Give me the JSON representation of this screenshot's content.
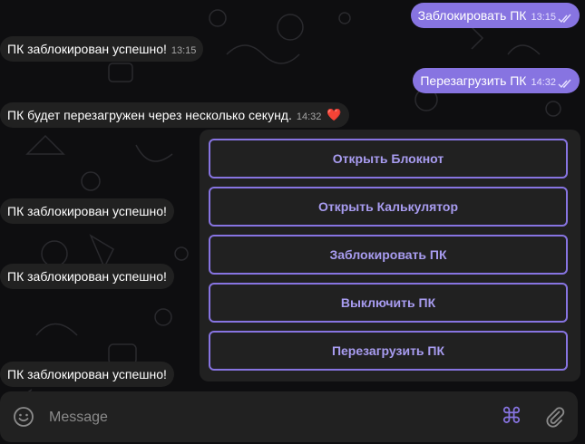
{
  "messages": [
    {
      "dir": "out",
      "text": "Заблокировать ПК",
      "time": "13:15",
      "read": true
    },
    {
      "dir": "in",
      "text": "ПК заблокирован успешно!",
      "time": "13:15"
    },
    {
      "dir": "out",
      "text": "Перезагрузить ПК",
      "time": "14:32",
      "read": true
    },
    {
      "dir": "in",
      "text": "ПК будет перезагружен через несколько секунд.",
      "time": "14:32",
      "reaction": "❤️"
    },
    {
      "dir": "in",
      "text": "ПК заблокирован успешно!"
    },
    {
      "dir": "in",
      "text": "ПК заблокирован успешно!"
    },
    {
      "dir": "in",
      "text": "ПК заблокирован успешно!"
    }
  ],
  "keyboard": {
    "buttons": [
      "Открыть Блокнот",
      "Открыть Калькулятор",
      "Заблокировать ПК",
      "Выключить ПК",
      "Перезагрузить ПК"
    ]
  },
  "composer": {
    "placeholder": "Message",
    "emoji_icon": "smile-icon",
    "commands_icon": "command-icon",
    "command_glyph": "⌘",
    "attach_icon": "paperclip-icon"
  },
  "colors": {
    "accent": "#8774e1",
    "incoming_bubble": "#212121",
    "background": "#0e0e10"
  }
}
